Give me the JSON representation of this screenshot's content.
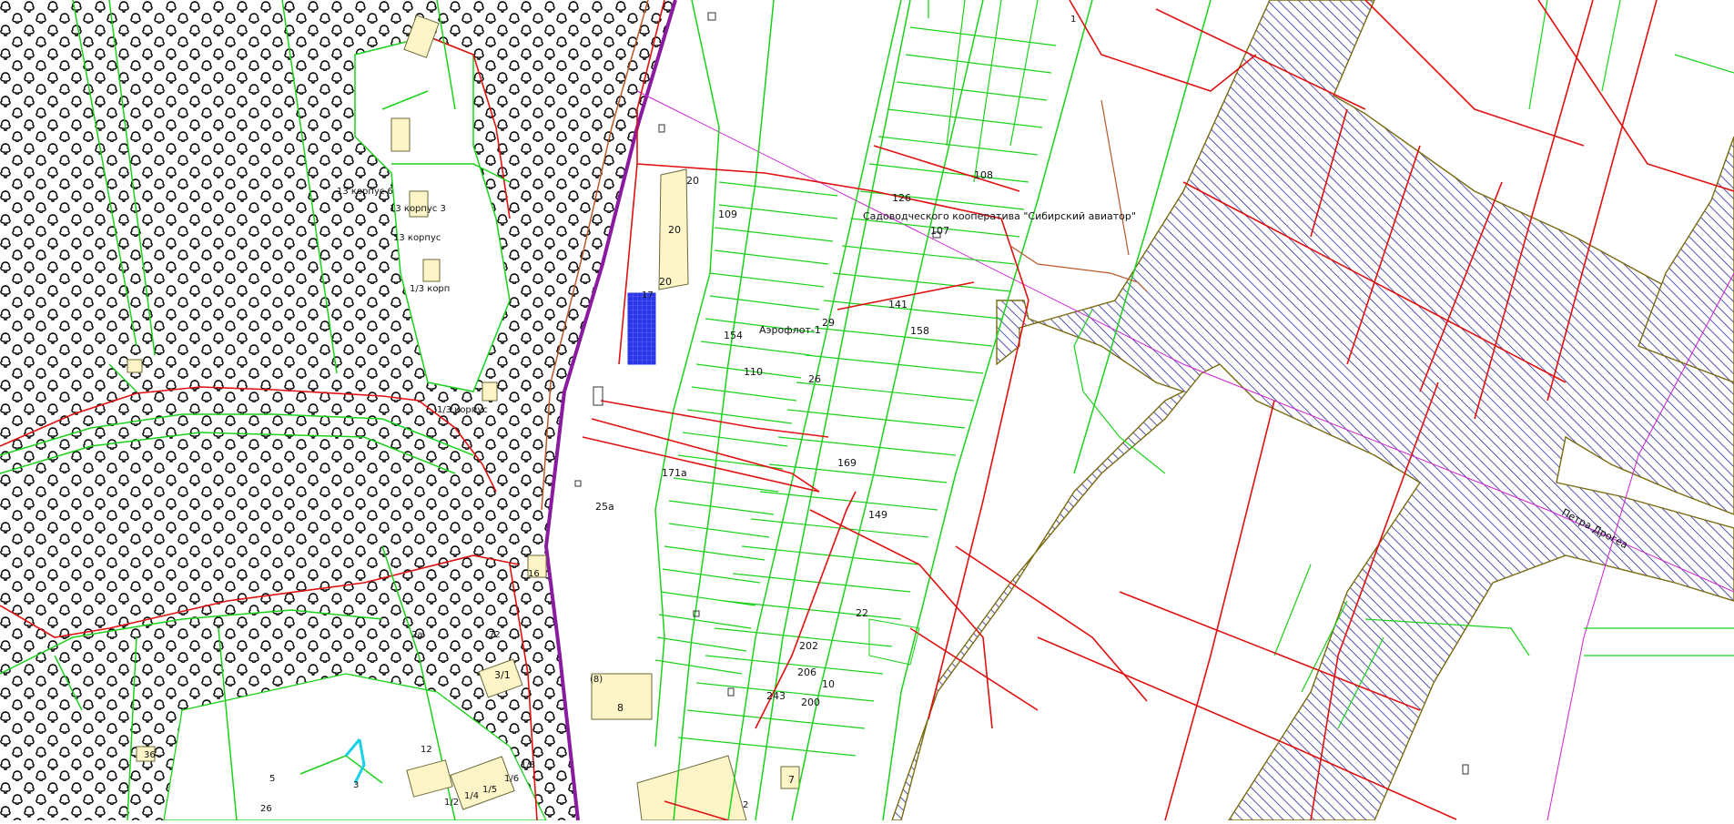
{
  "map": {
    "colors": {
      "background": "#ffffff",
      "forest_pattern": "#000000",
      "parcel_lines": "#19d219",
      "red_lines": "#e01010",
      "road_hatch": "#2a2aa0",
      "road_fill": "#ffffff",
      "road_edge": "#7a6a10",
      "purple_line": "#8a1aa0",
      "building_fill": "#fdf5c8",
      "building_stroke": "#6a6a3a",
      "water_object": "#2a36e8",
      "magenta_line": "#d020d0",
      "brown_line": "#b8582a"
    },
    "labels": {
      "sad_koop": "Садоводческого кооператива \"Сибирский авиатор\"",
      "aeroflot": "Аэрофлот-1",
      "street": "Петра Дрогеа",
      "korpus6": "13 корпус 6",
      "korpus3": "13 корпус 3",
      "korpus5": "13 корпус",
      "korpus_a": "1/3 корп",
      "korpus_b": "1/3 корпус",
      "b20a": "20",
      "b20b": "20",
      "b20c": "20",
      "n1": "1",
      "n17": "17",
      "n109": "109",
      "n154": "154",
      "n110": "110",
      "n29": "29",
      "n26": "26",
      "n108": "108",
      "n126": "126",
      "n107": "107",
      "n141": "141",
      "n158": "158",
      "n169": "169",
      "n149": "149",
      "n22": "22",
      "n202": "202",
      "n206": "206",
      "n10": "10",
      "n243": "243",
      "n200": "200",
      "n171a": "171а",
      "n25a": "25а",
      "n3_1": "3/1",
      "n8": "8",
      "n8b": "(8)",
      "n7": "7",
      "n36": "36",
      "n72": "72",
      "n1_2": "1/2",
      "n1_4": "1/4",
      "n1_5": "1/5",
      "n1_6": "1/6",
      "n1_8": "1/8",
      "n12": "12",
      "n3": "3",
      "n5": "5",
      "n26b": "26",
      "n2a": "2а",
      "n16": "16",
      "n2": "2"
    }
  }
}
